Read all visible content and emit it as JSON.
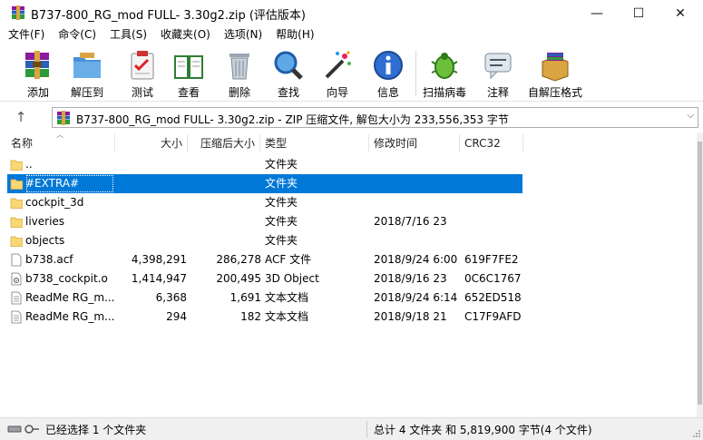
{
  "window": {
    "title": "B737-800_RG_mod FULL- 3.30g2.zip (评估版本)",
    "minimize": "—",
    "maximize": "☐",
    "close": "✕"
  },
  "menu": [
    "文件(F)",
    "命令(C)",
    "工具(S)",
    "收藏夹(O)",
    "选项(N)",
    "帮助(H)"
  ],
  "toolbar": {
    "add": "添加",
    "extract_to": "解压到",
    "test": "测试",
    "view": "查看",
    "delete": "删除",
    "find": "查找",
    "wizard": "向导",
    "info": "信息",
    "virus_scan": "扫描病毒",
    "comment": "注释",
    "sfx": "自解压格式"
  },
  "address": {
    "up": "↑",
    "text": "B737-800_RG_mod FULL- 3.30g2.zip - ZIP 压缩文件, 解包大小为 233,556,353 字节",
    "dropdown": "⌵"
  },
  "columns": {
    "name": "名称",
    "size": "大小",
    "packed": "压缩后大小",
    "type": "类型",
    "modified": "修改时间",
    "crc": "CRC32"
  },
  "files": [
    {
      "name": "..",
      "size": "",
      "packed": "",
      "type": "文件夹",
      "modified": "",
      "crc": "",
      "icon": "folder-up-icon"
    },
    {
      "name": "#EXTRA#",
      "size": "",
      "packed": "",
      "type": "文件夹",
      "modified": "",
      "crc": "",
      "icon": "folder-icon",
      "selected": true
    },
    {
      "name": "cockpit_3d",
      "size": "",
      "packed": "",
      "type": "文件夹",
      "modified": "",
      "crc": "",
      "icon": "folder-icon"
    },
    {
      "name": "liveries",
      "size": "",
      "packed": "",
      "type": "文件夹",
      "modified": "2018/7/16 23",
      "crc": "",
      "icon": "folder-icon"
    },
    {
      "name": "objects",
      "size": "",
      "packed": "",
      "type": "文件夹",
      "modified": "",
      "crc": "",
      "icon": "folder-icon"
    },
    {
      "name": "b738.acf",
      "size": "4,398,291",
      "packed": "286,278",
      "type": "ACF 文件",
      "modified": "2018/9/24 6:00",
      "crc": "619F7FE2",
      "icon": "file-icon"
    },
    {
      "name": "b738_cockpit.o",
      "size": "1,414,947",
      "packed": "200,495",
      "type": "3D Object",
      "modified": "2018/9/16 23",
      "crc": "0C6C1767",
      "icon": "object-file-icon"
    },
    {
      "name": "ReadMe RG_m...",
      "size": "6,368",
      "packed": "1,691",
      "type": "文本文档",
      "modified": "2018/9/24 6:14",
      "crc": "652ED518",
      "icon": "text-file-icon"
    },
    {
      "name": "ReadMe RG_m...",
      "size": "294",
      "packed": "182",
      "type": "文本文档",
      "modified": "2018/9/18 21",
      "crc": "C17F9AFD",
      "icon": "text-file-icon"
    }
  ],
  "status": {
    "left": "已经选择 1 个文件夹",
    "right": "总计 4 文件夹 和 5,819,900 字节(4 个文件)"
  },
  "colors": {
    "selection": "#0078d7",
    "folder": "#f8d775"
  }
}
